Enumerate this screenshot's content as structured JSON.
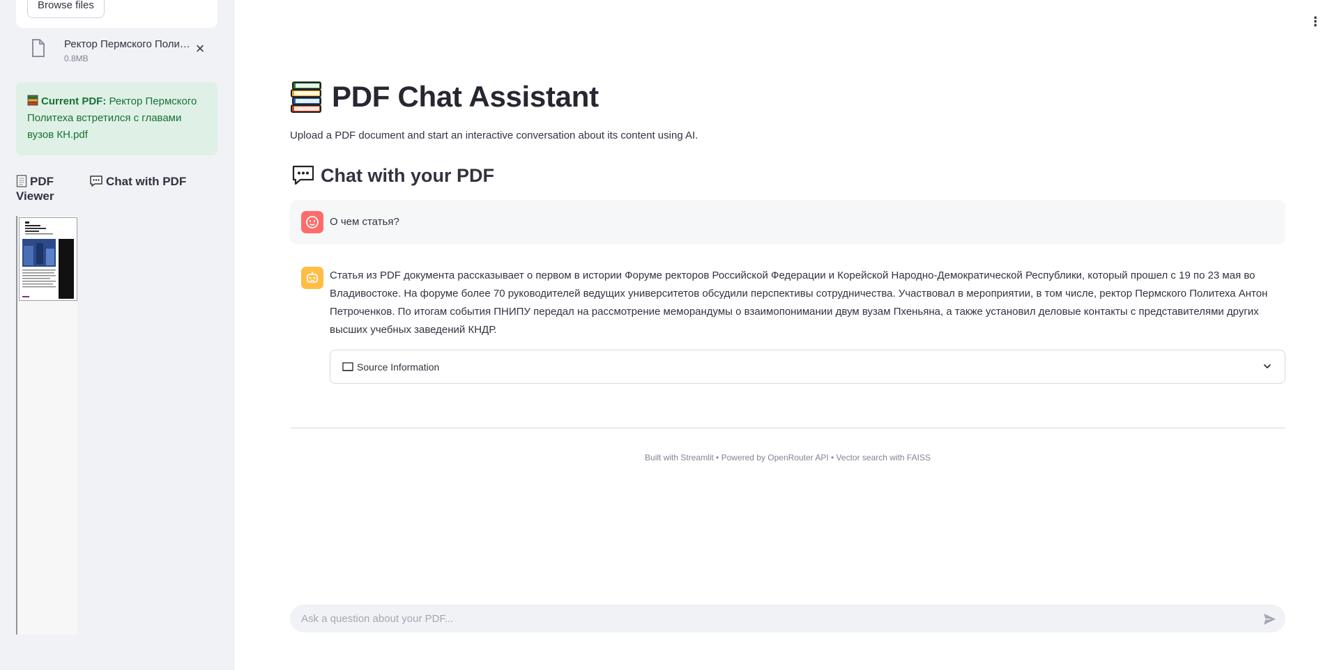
{
  "sidebar": {
    "browse_label": "Browse files",
    "file": {
      "name": "Ректор Пермского Поли…",
      "size": "0.8MB"
    },
    "current": {
      "label": "Current PDF:",
      "value": "Ректор Пермского Политеха встретился с главами вузов КН.pdf"
    },
    "tabs": [
      {
        "label": "PDF Viewer",
        "icon": "page-icon"
      },
      {
        "label": "Chat with PDF",
        "icon": "speech-bubble-icon"
      }
    ]
  },
  "header": {
    "title": "PDF Chat Assistant",
    "subtitle": "Upload a PDF document and start an interactive conversation about its content using AI."
  },
  "chat": {
    "title": "Chat with your PDF",
    "messages": [
      {
        "role": "user",
        "text": "О чем статья?"
      },
      {
        "role": "assistant",
        "text": "Статья из PDF документа рассказывает о первом в истории Форуме ректоров Российской Федерации и Корейской Народно-Демократической Республики, который прошел с 19 по 23 мая во Владивостоке. На форуме более 70 руководителей ведущих университетов обсудили перспективы сотрудничества. Участвовал в мероприятии, в том числе, ректор Пермского Политеха Антон Петроченков. По итогам события ПНИПУ передал на рассмотрение меморандумы о взаимопонимании двум вузам Пхеньяна, а также установил деловые контакты с представителями других высших учебных заведений КНДР."
      }
    ],
    "source_label": "Source Information",
    "input_placeholder": "Ask a question about your PDF..."
  },
  "footer": "Built with Streamlit • Powered by OpenRouter API • Vector search with FAISS",
  "colors": {
    "sidebar_bg": "#f0f2f6",
    "success_bg": "#dff0e6",
    "success_text": "#177233",
    "user_avatar": "#ff6b6b",
    "bot_avatar": "#ffbd45"
  }
}
